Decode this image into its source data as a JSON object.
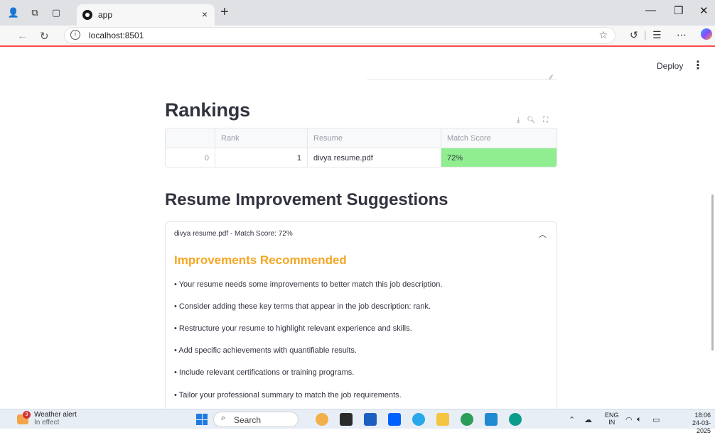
{
  "browser": {
    "tab_title": "app",
    "url": "localhost:8501"
  },
  "app": {
    "deploy_label": "Deploy",
    "rankings_heading": "Rankings",
    "table": {
      "columns": [
        "",
        "Rank",
        "Resume",
        "Match Score"
      ],
      "rows": [
        {
          "index": "0",
          "rank": "1",
          "resume": "divya resume.pdf",
          "match_score": "72%"
        }
      ],
      "highlight_color": "#90ee90"
    },
    "suggestions_heading": "Resume Improvement Suggestions",
    "expander": {
      "title": "divya resume.pdf - Match Score: 72%",
      "section_title": "Improvements Recommended",
      "section_color": "#f5a623",
      "items": [
        "• Your resume needs some improvements to better match this job description.",
        "• Consider adding these key terms that appear in the job description: rank.",
        "• Restructure your resume to highlight relevant experience and skills.",
        "• Add specific achievements with quantifiable results.",
        "• Include relevant certifications or training programs.",
        "• Tailor your professional summary to match the job requirements."
      ]
    }
  },
  "taskbar": {
    "weather_badge": "3",
    "weather_title": "Weather alert",
    "weather_subtitle": "In effect",
    "search_label": "Search",
    "lang_line1": "ENG",
    "lang_line2": "IN",
    "time": "18:06",
    "date": "24-03-2025"
  }
}
